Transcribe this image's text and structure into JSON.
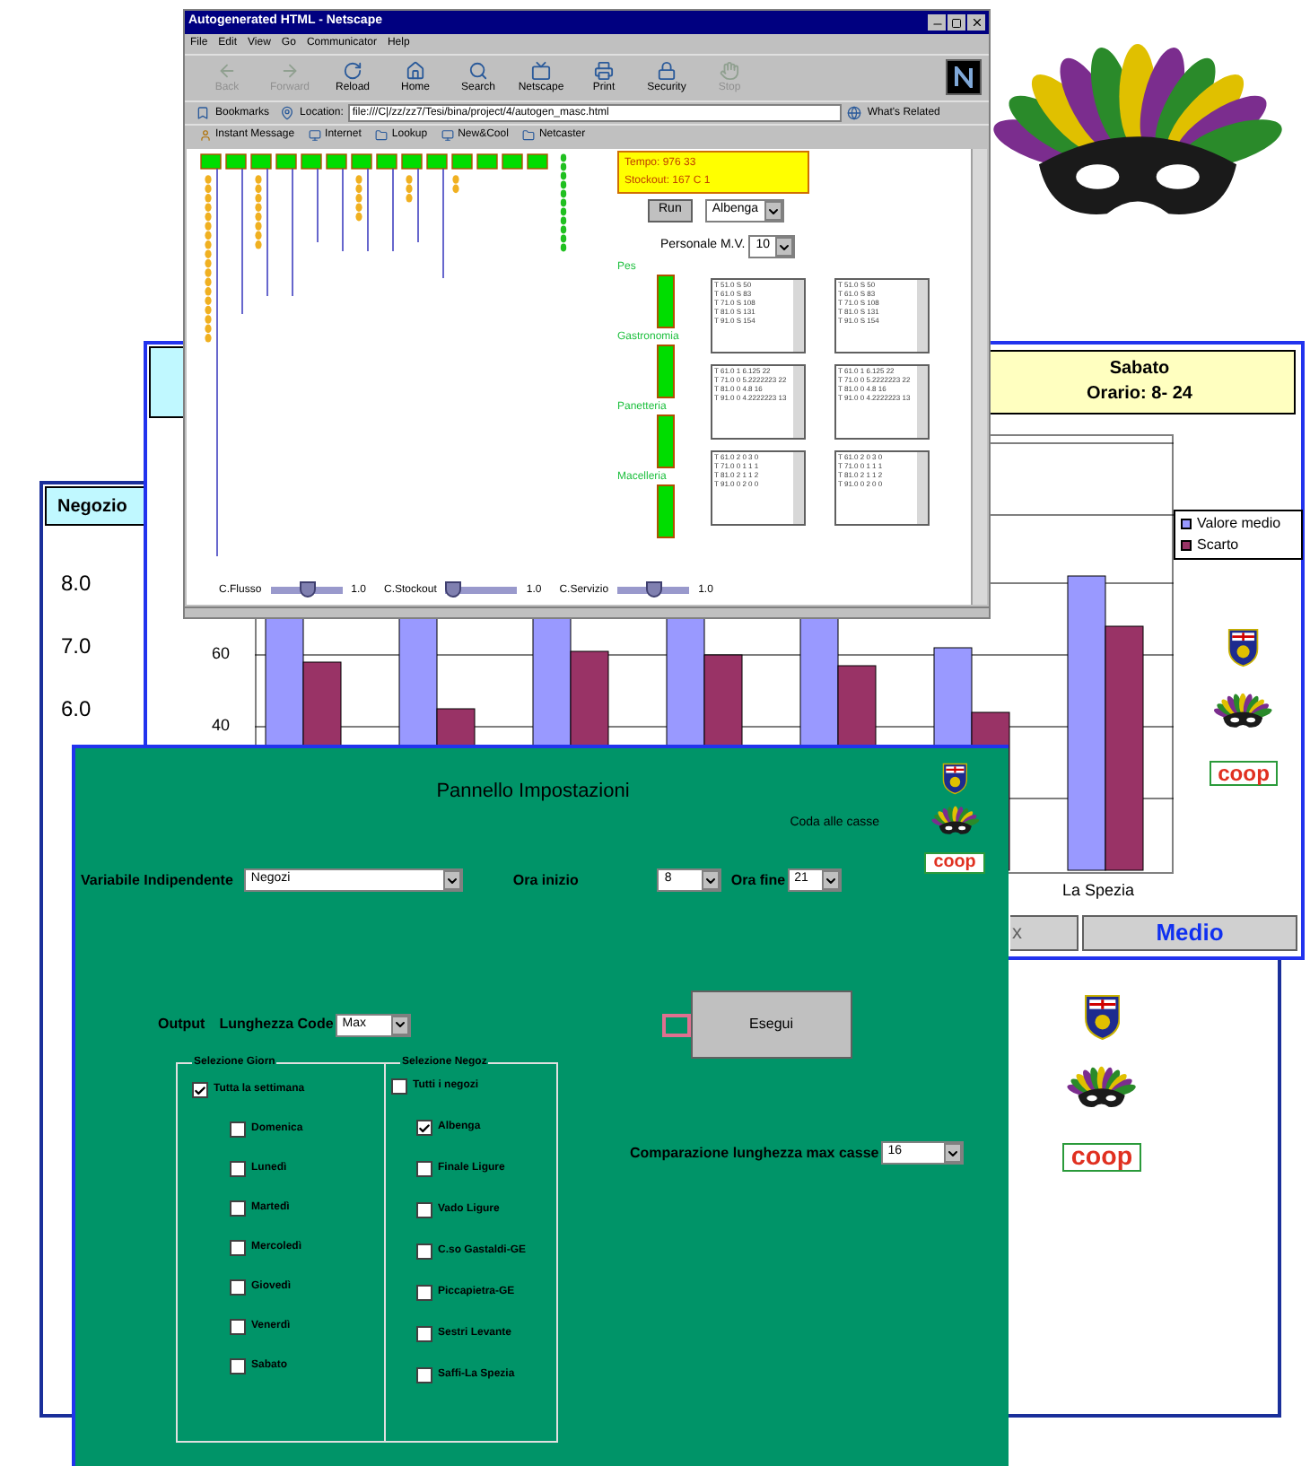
{
  "report_back": {
    "header": "Negozio",
    "y_tick_labels": [
      "8.0",
      "7.0",
      "6.0"
    ],
    "logos": [
      {
        "kind": "crest"
      },
      {
        "kind": "mask"
      },
      {
        "kind": "coop",
        "text": "coop"
      }
    ]
  },
  "report": {
    "day": "Sabato",
    "hours": "Orario: 8- 24",
    "y_tick_labels": [
      "60",
      "40"
    ],
    "x_label": "La Spezia",
    "legend": [
      {
        "label": "Valore medio",
        "color": "#9999ff"
      },
      {
        "label": "Scarto",
        "color": "#993366"
      }
    ],
    "logos": [
      {
        "kind": "crest"
      },
      {
        "kind": "mask"
      },
      {
        "kind": "coop",
        "text": "coop"
      }
    ],
    "buttons": [
      {
        "label": "x",
        "emphasis": false
      },
      {
        "label": "Medio",
        "emphasis": true
      }
    ]
  },
  "browser": {
    "title": "Autogenerated HTML - Netscape",
    "menu": [
      "File",
      "Edit",
      "View",
      "Go",
      "Communicator",
      "Help"
    ],
    "toolbar": [
      {
        "kind": "back",
        "label": "Back",
        "disabled": true
      },
      {
        "kind": "forward",
        "label": "Forward",
        "disabled": true
      },
      {
        "kind": "reload",
        "label": "Reload",
        "disabled": false
      },
      {
        "kind": "home",
        "label": "Home",
        "disabled": false
      },
      {
        "kind": "search",
        "label": "Search",
        "disabled": false
      },
      {
        "kind": "netscape",
        "label": "Netscape",
        "disabled": false
      },
      {
        "kind": "print",
        "label": "Print",
        "disabled": false
      },
      {
        "kind": "security",
        "label": "Security",
        "disabled": false
      },
      {
        "kind": "stop",
        "label": "Stop",
        "disabled": true
      }
    ],
    "bookmarks": "Bookmarks",
    "location_label": "Location:",
    "url": "file:///C|/zz/zz7/Tesi/bina/project/4/autogen_masc.html",
    "related": "What's Related",
    "personal_toolbar": [
      "Instant Message",
      "Internet",
      "Lookup",
      "New&Cool",
      "Netcaster"
    ],
    "time": "Tempo: 976 33",
    "stockout": "Stockout: 167 C 1",
    "run": "Run",
    "store": "Albenga",
    "staff_label": "Personale M.V.",
    "staff": "10",
    "departments": [
      "Pes",
      "Gastronomia",
      "Panetteria",
      "Macelleria"
    ],
    "lists": [
      {
        "left": [
          "T 51.0 S 50",
          "T 61.0 S 83",
          "T 71.0 S 108",
          "T 81.0 S 131",
          "T 91.0 S 154"
        ],
        "right": [
          "T 51.0 S 50",
          "T 61.0 S 83",
          "T 71.0 S 108",
          "T 81.0 S 131",
          "T 91.0 S 154"
        ]
      },
      {
        "left": [
          "T 61.0 1 6.125 22",
          "T 71.0 0 5.2222223 22",
          "T 81.0 0 4.8 16",
          "T 91.0 0 4.2222223 13"
        ],
        "right": [
          "T 61.0 1 6.125 22",
          "T 71.0 0 5.2222223 22",
          "T 81.0 0 4.8 16",
          "T 91.0 0 4.2222223 13"
        ]
      },
      {
        "left": [
          "T 61.0 2 0 3 0",
          "T 71.0 0 1 1 1",
          "T 81.0 2 1 1 2",
          "T 91.0 0 2 0 0"
        ],
        "right": [
          "T 61.0 2 0 3 0",
          "T 71.0 0 1 1 1",
          "T 81.0 2 1 1 2",
          "T 91.0 0 2 0 0"
        ]
      }
    ],
    "sliders": [
      {
        "label": "C.Flusso",
        "level": 0.5,
        "reading": "1.0"
      },
      {
        "label": "C.Stockout",
        "level": 0.1,
        "reading": "1.0"
      },
      {
        "label": "C.Servizio",
        "level": 0.5,
        "reading": "1.0"
      }
    ]
  },
  "settings": {
    "title": "Pannello Impostazioni",
    "queue_label": "Coda alle casse",
    "logos": [
      {
        "kind": "crest"
      },
      {
        "kind": "mask"
      },
      {
        "kind": "coop",
        "text": "coop"
      }
    ],
    "variable_label": "Variabile Indipendente",
    "variable": "Negozi",
    "start_label": "Ora inizio",
    "start": "8",
    "end_label": "Ora fine",
    "end": "21",
    "output_label": "Output",
    "length_label": "Lunghezza Code",
    "length": "Max",
    "run": "Esegui",
    "days_title": "Selezione Giorn",
    "days": [
      {
        "label": "Tutta la settimana",
        "checked": true
      },
      {
        "label": "Domenica",
        "checked": false
      },
      {
        "label": "Lunedì",
        "checked": false
      },
      {
        "label": "Martedì",
        "checked": false
      },
      {
        "label": "Mercoledì",
        "checked": false
      },
      {
        "label": "Giovedì",
        "checked": false
      },
      {
        "label": "Venerdì",
        "checked": false
      },
      {
        "label": "Sabato",
        "checked": false
      }
    ],
    "stores_title": "Selezione Negoz",
    "stores": [
      {
        "label": "Tutti i negozi",
        "checked": false
      },
      {
        "label": "Albenga",
        "checked": true
      },
      {
        "label": "Finale Ligure",
        "checked": false
      },
      {
        "label": "Vado Ligure",
        "checked": false
      },
      {
        "label": "C.so Gastaldi-GE",
        "checked": false
      },
      {
        "label": "Piccapietra-GE",
        "checked": false
      },
      {
        "label": "Sestri Levante",
        "checked": false
      },
      {
        "label": "Saffi-La Spezia",
        "checked": false
      }
    ],
    "compare_label": "Comparazione lunghezza max casse",
    "compare": "16"
  }
}
